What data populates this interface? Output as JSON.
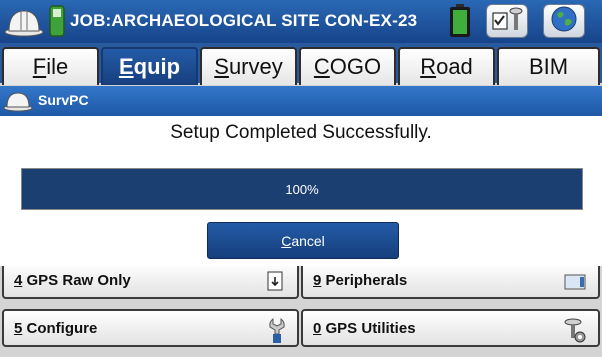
{
  "titlebar": {
    "job_title": "JOB:ARCHAEOLOGICAL SITE CON-EX-23",
    "icons": [
      "helmet-icon",
      "sd-card-icon",
      "battery-icon",
      "gps-checklist-icon",
      "globe-icon"
    ]
  },
  "tabs": [
    {
      "label": "File",
      "u": "F",
      "rest": "ile"
    },
    {
      "label": "Equip",
      "u": "E",
      "rest": "quip"
    },
    {
      "label": "Survey",
      "u": "S",
      "rest": "urvey"
    },
    {
      "label": "COGO",
      "u": "C",
      "rest": "OGO"
    },
    {
      "label": "Road",
      "u": "R",
      "rest": "oad"
    },
    {
      "label": "BIM",
      "u": "",
      "rest": "BIM"
    }
  ],
  "active_tab": "Equip",
  "dialog": {
    "title": "SurvPC",
    "message": "Setup Completed Successfully.",
    "progress_value": 100,
    "progress_text": "100%",
    "cancel_u": "C",
    "cancel_rest": "ancel"
  },
  "menu": [
    {
      "num": "4",
      "text": " GPS Raw Only",
      "icon": "raw-file-icon"
    },
    {
      "num": "9",
      "text": " Peripherals",
      "icon": "device-icon"
    },
    {
      "num": "5",
      "text": " Configure",
      "icon": "wrench-icon"
    },
    {
      "num": "0",
      "text": " GPS Utilities",
      "icon": "gps-gear-icon"
    }
  ],
  "colors": {
    "titlebar": "#1f5aa5",
    "active_tab": "#1c4d92",
    "progress_fill": "#1c3f72"
  }
}
